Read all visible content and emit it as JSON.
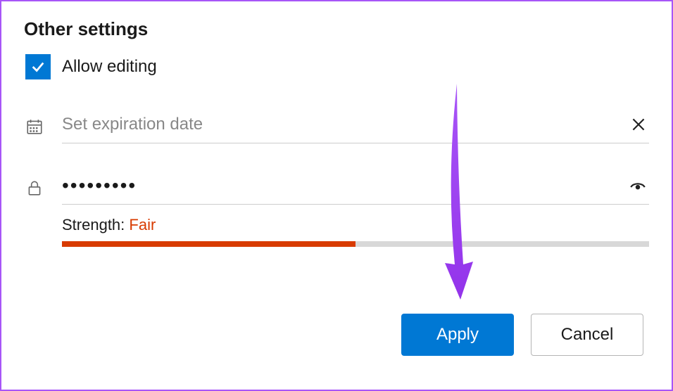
{
  "section_title": "Other settings",
  "allow_editing": {
    "label": "Allow editing",
    "checked": true
  },
  "expiration": {
    "placeholder": "Set expiration date",
    "value": ""
  },
  "password": {
    "masked_value": "•••••••••",
    "strength_label": "Strength: ",
    "strength_value": "Fair",
    "strength_percent": 50
  },
  "buttons": {
    "apply": "Apply",
    "cancel": "Cancel"
  },
  "colors": {
    "primary": "#0078d4",
    "strength": "#d83b01",
    "annotation": "#a855f7"
  }
}
